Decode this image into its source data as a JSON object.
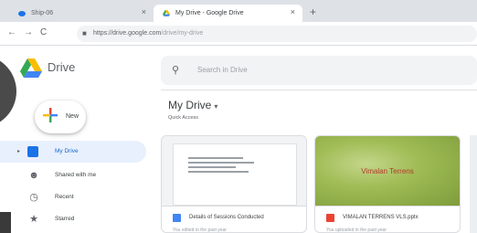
{
  "browser": {
    "tabs": [
      {
        "label": "Ship-06"
      },
      {
        "label": "My Drive - Google Drive"
      }
    ],
    "new_tab_icon": "plus-icon",
    "nav": {
      "back": "←",
      "forward": "→",
      "reload": "C"
    },
    "url": {
      "host": "https://drive.google.com",
      "path": "/drive/my-drive"
    }
  },
  "app": {
    "name": "Drive",
    "search_placeholder": "Search in Drive"
  },
  "sidebar": {
    "new_label": "New",
    "items": [
      {
        "label": "My Drive",
        "icon": "my-drive-icon",
        "active": true
      },
      {
        "label": "Shared with me",
        "icon": "shared-with-me-icon",
        "active": false
      },
      {
        "label": "Recent",
        "icon": "clock-icon",
        "active": false
      },
      {
        "label": "Starred",
        "icon": "star-icon",
        "active": false
      }
    ]
  },
  "main": {
    "title": "My Drive",
    "quick_access_label": "Quick Access",
    "files": [
      {
        "name": "Details of Sessions Conducted",
        "type": "doc",
        "subtitle": "You edited in the past year",
        "type_color": "#4285f4"
      },
      {
        "name": "VIMALAN TERRENS VLS.pptx",
        "type": "slides",
        "subtitle": "You uploaded in the past year",
        "slide_title": "Vimalan Terrens",
        "type_color": "#ea4335"
      }
    ]
  },
  "colors": {
    "accent": "#1a73e8",
    "active_bg": "#e8f0fe",
    "chrome": "#dee1e6"
  }
}
